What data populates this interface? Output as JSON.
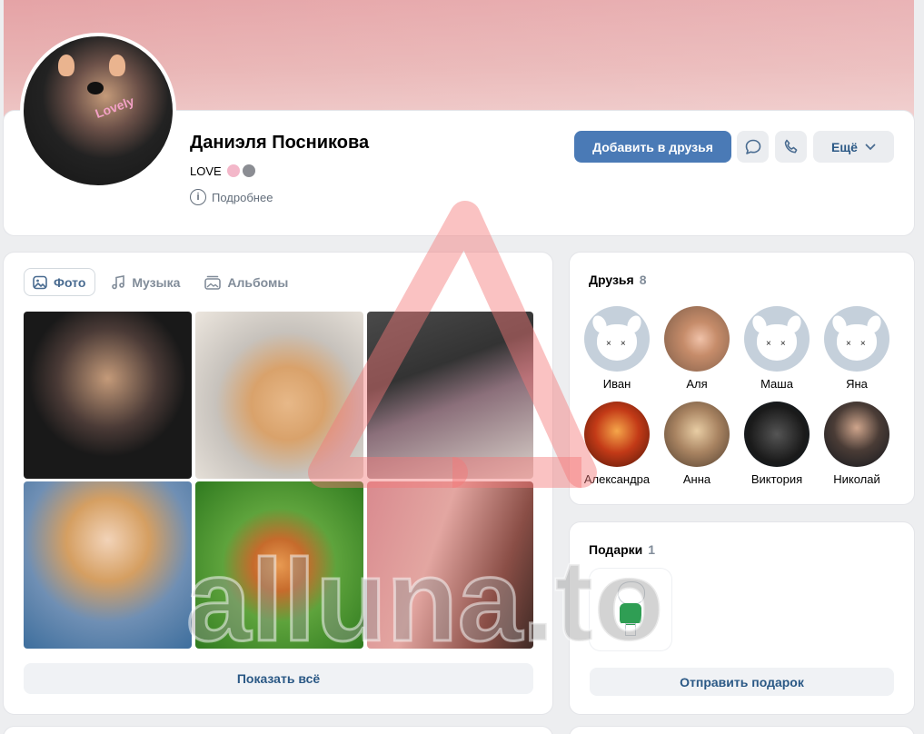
{
  "profile": {
    "name": "Даниэля Посникова",
    "status": "LOVE",
    "details_link": "Подробнее",
    "add_friend_label": "Добавить в друзья",
    "more_label": "Ещё",
    "avatar_caption": "Lovely"
  },
  "photos": {
    "tabs": [
      {
        "label": "Фото",
        "active": true
      },
      {
        "label": "Музыка",
        "active": false
      },
      {
        "label": "Альбомы",
        "active": false
      }
    ],
    "show_all_label": "Показать всё"
  },
  "friends": {
    "title": "Друзья",
    "count": "8",
    "items": [
      {
        "name": "Иван"
      },
      {
        "name": "Аля"
      },
      {
        "name": "Маша"
      },
      {
        "name": "Яна"
      },
      {
        "name": "Александра"
      },
      {
        "name": "Анна"
      },
      {
        "name": "Виктория"
      },
      {
        "name": "Николай"
      }
    ]
  },
  "gifts": {
    "title": "Подарки",
    "count": "1",
    "send_label": "Отправить подарок"
  },
  "watermark": {
    "text": "alluna.to"
  },
  "colors": {
    "primary_button": "#4a7ab6",
    "link": "#2a5885",
    "cover": "#e5a3a6",
    "background": "#edeef0"
  }
}
